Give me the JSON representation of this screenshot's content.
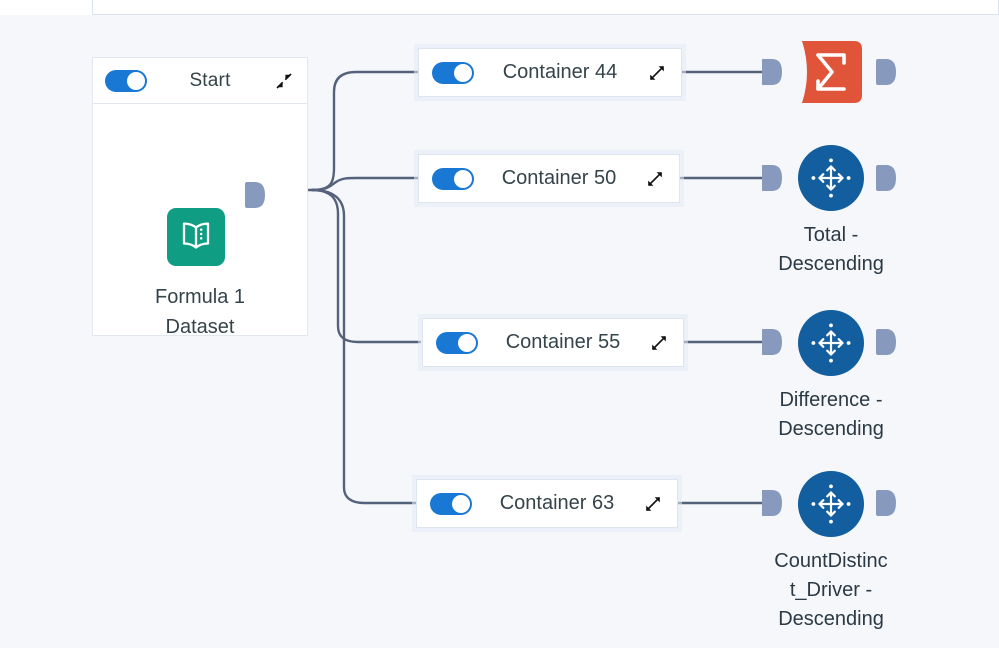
{
  "canvas": {
    "background_color": "#f5f7fa",
    "wire_color": "#55627c",
    "port_color": "#8799bd"
  },
  "start_node": {
    "title": "Start",
    "toggle_on": true,
    "toggle_color": "#1878d4",
    "collapse_icon": "collapse-arrows-icon",
    "dataset": {
      "label": "Formula 1 Dataset",
      "label_line1": "Formula 1",
      "label_line2": "Dataset",
      "icon": "book-dataset-icon",
      "icon_color": "#0f9e84"
    }
  },
  "containers": [
    {
      "label": "Container 44",
      "toggle_on": true,
      "expand_icon": "expand-arrows-icon"
    },
    {
      "label": "Container 50",
      "toggle_on": true,
      "expand_icon": "expand-arrows-icon"
    },
    {
      "label": "Container 55",
      "toggle_on": true,
      "expand_icon": "expand-arrows-icon"
    },
    {
      "label": "Container 63",
      "toggle_on": true,
      "expand_icon": "expand-arrows-icon"
    }
  ],
  "tools": [
    {
      "kind": "summarize",
      "icon": "sigma-summarize-icon",
      "color": "#e0543a",
      "label": "",
      "label_line1": "",
      "label_line2": "",
      "label_line3": ""
    },
    {
      "kind": "sort",
      "icon": "four-way-arrow-icon",
      "color": "#125e9e",
      "label": "Total - Descending",
      "label_line1": "Total -",
      "label_line2": "Descending",
      "label_line3": ""
    },
    {
      "kind": "sort",
      "icon": "four-way-arrow-icon",
      "color": "#125e9e",
      "label": "Difference - Descending",
      "label_line1": "Difference -",
      "label_line2": "Descending",
      "label_line3": ""
    },
    {
      "kind": "sort",
      "icon": "four-way-arrow-icon",
      "color": "#125e9e",
      "label": "CountDistinct_Driver - Descending",
      "label_line1": "CountDistinc",
      "label_line2": "t_Driver -",
      "label_line3": "Descending"
    }
  ]
}
